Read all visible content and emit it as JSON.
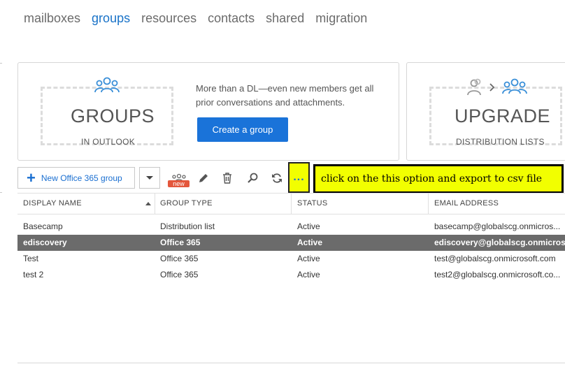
{
  "nav": {
    "items": [
      {
        "label": "mailboxes",
        "active": false
      },
      {
        "label": "groups",
        "active": true
      },
      {
        "label": "resources",
        "active": false
      },
      {
        "label": "contacts",
        "active": false
      },
      {
        "label": "shared",
        "active": false
      },
      {
        "label": "migration",
        "active": false
      }
    ]
  },
  "promo_groups": {
    "icon": "people-group-icon",
    "big_word": "GROUPS",
    "small_word": "IN OUTLOOK",
    "description": "More than a DL—even new members get all prior conversations and attachments.",
    "button_label": "Create a group"
  },
  "promo_upgrade": {
    "icon": "upgrade-person-to-group-icon",
    "big_word": "UPGRADE",
    "small_word": "DISTRIBUTION LISTS"
  },
  "toolbar": {
    "new_label": "New Office 365 group",
    "new_badge": "new",
    "tools": [
      "dropdown-chevron-icon",
      "new-group-icon",
      "edit-pencil-icon",
      "delete-trash-icon",
      "search-icon",
      "refresh-icon",
      "more-options-icon"
    ],
    "more_label": "...",
    "callout_text": "click on the this option and export to csv file"
  },
  "table": {
    "columns": [
      "DISPLAY NAME",
      "GROUP TYPE",
      "STATUS",
      "EMAIL ADDRESS"
    ],
    "sorted_column": "DISPLAY NAME",
    "sort_direction": "ascending",
    "rows": [
      {
        "name": "Basecamp",
        "type": "Distribution list",
        "status": "Active",
        "email": "basecamp@globalscg.onmicros...",
        "selected": false
      },
      {
        "name": "ediscovery",
        "type": "Office 365",
        "status": "Active",
        "email": "ediscovery@globalscg.onmicros...",
        "selected": true
      },
      {
        "name": "Test",
        "type": "Office 365",
        "status": "Active",
        "email": "test@globalscg.onmicrosoft.com",
        "selected": false
      },
      {
        "name": "test 2",
        "type": "Office 365",
        "status": "Active",
        "email": "test2@globalscg.onmicrosoft.co...",
        "selected": false
      }
    ]
  },
  "colors": {
    "accent": "#1a73d9",
    "highlight": "#f2ff00",
    "selected_row": "#6b6b6b",
    "badge": "#e4573c"
  }
}
